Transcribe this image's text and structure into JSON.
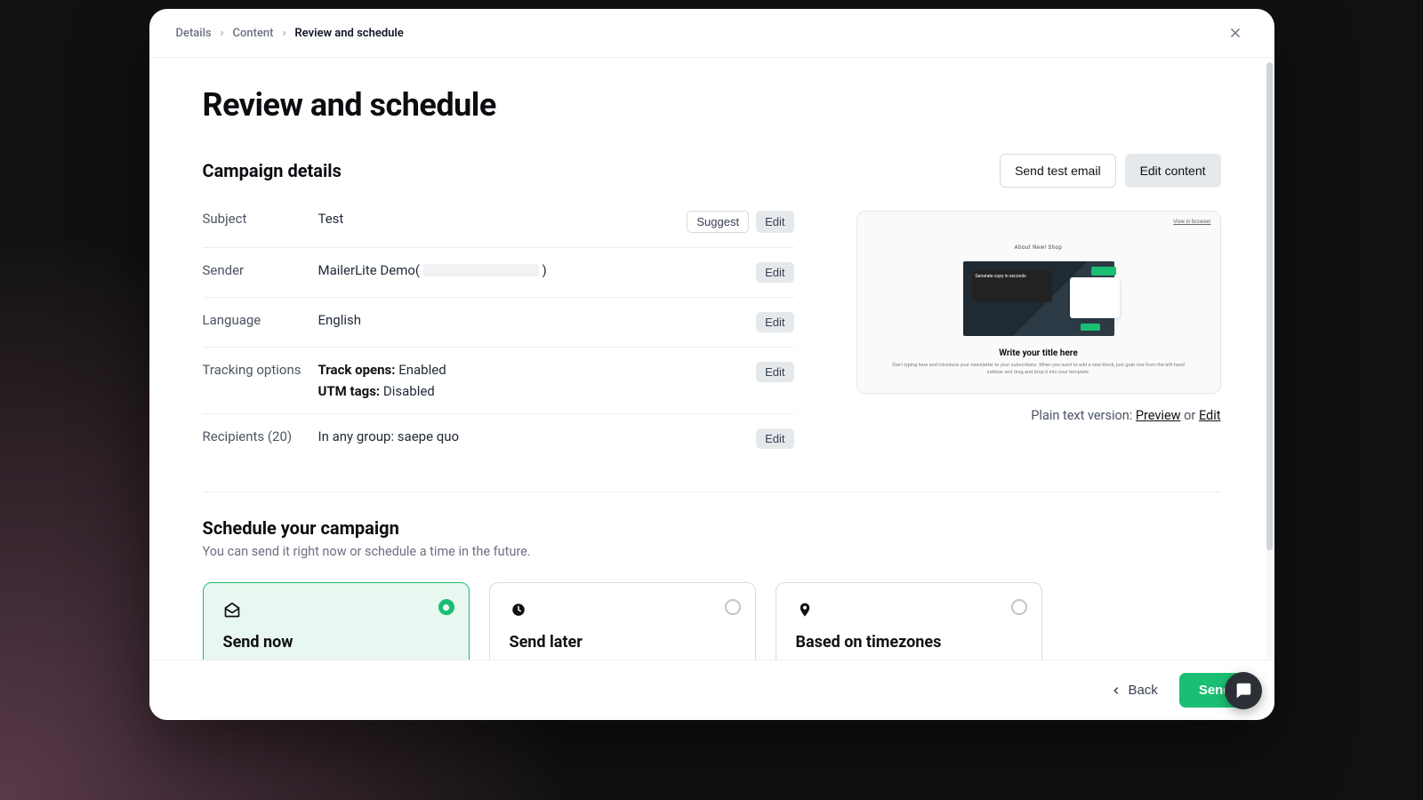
{
  "breadcrumbs": {
    "items": [
      "Details",
      "Content",
      "Review and schedule"
    ],
    "active_index": 2
  },
  "page_title": "Review and schedule",
  "campaign_details": {
    "title": "Campaign details",
    "buttons": {
      "send_test": "Send test email",
      "edit_content": "Edit content"
    },
    "rows": {
      "subject": {
        "label": "Subject",
        "value": "Test",
        "suggest": "Suggest",
        "edit": "Edit"
      },
      "sender": {
        "label": "Sender",
        "prefix": "MailerLite Demo(",
        "suffix": ")",
        "edit": "Edit"
      },
      "language": {
        "label": "Language",
        "value": "English",
        "edit": "Edit"
      },
      "tracking": {
        "label": "Tracking options",
        "opens_key": "Track opens:",
        "opens_val": " Enabled",
        "utm_key": "UTM tags:",
        "utm_val": " Disabled",
        "edit": "Edit"
      },
      "recipients": {
        "label": "Recipients (20)",
        "value": "In any group: saepe quo",
        "edit": "Edit"
      }
    }
  },
  "preview": {
    "view_in_browser": "View in browser",
    "nav": "About      New!      Shop",
    "hero_card_text": "Generate copy in seconds",
    "title": "Write your title here",
    "body": "Start typing here and introduce your newsletter to your subscribers. When you want to add a new block, just grab one from the left-hand sidebar and drag and drop it into your template.",
    "footer_prefix": "Plain text version: ",
    "preview_link": "Preview",
    "or": " or ",
    "edit_link": "Edit"
  },
  "schedule": {
    "title": "Schedule your campaign",
    "description": "You can send it right now or schedule a time in the future.",
    "options": [
      {
        "id": "send-now",
        "label": "Send now",
        "icon": "mail",
        "selected": true
      },
      {
        "id": "send-later",
        "label": "Send later",
        "icon": "clock",
        "selected": false
      },
      {
        "id": "timezones",
        "label": "Based on timezones",
        "icon": "pin",
        "selected": false
      }
    ]
  },
  "bottombar": {
    "back": "Back",
    "send": "Send"
  },
  "colors": {
    "accent": "#1bbf73"
  }
}
